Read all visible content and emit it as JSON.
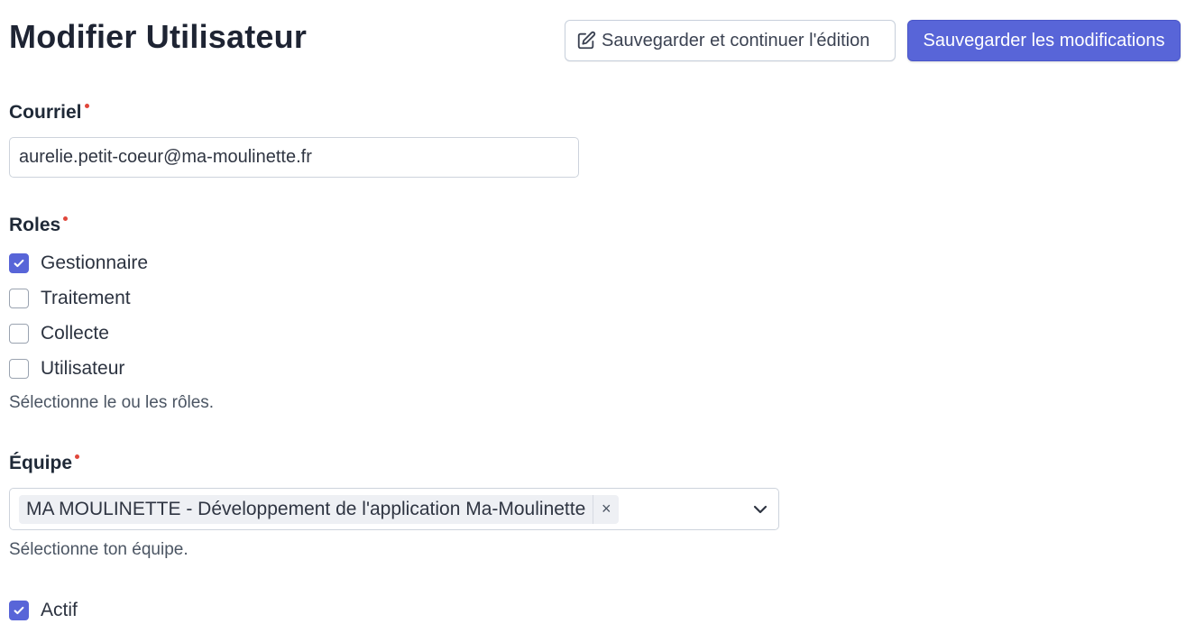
{
  "header": {
    "title": "Modifier Utilisateur",
    "save_continue_label": "Sauvegarder et continuer l'édition",
    "save_label": "Sauvegarder les modifications"
  },
  "form": {
    "email": {
      "label": "Courriel",
      "value": "aurelie.petit-coeur@ma-moulinette.fr"
    },
    "roles": {
      "label": "Roles",
      "options": [
        {
          "label": "Gestionnaire",
          "checked": true
        },
        {
          "label": "Traitement",
          "checked": false
        },
        {
          "label": "Collecte",
          "checked": false
        },
        {
          "label": "Utilisateur",
          "checked": false
        }
      ],
      "help": "Sélectionne le ou les rôles."
    },
    "team": {
      "label": "Équipe",
      "selected": "MA MOULINETTE - Développement de l'application Ma-Moulinette",
      "remove_glyph": "×",
      "help": "Sélectionne ton équipe."
    },
    "active": {
      "label": "Actif",
      "checked": true
    }
  },
  "colors": {
    "accent": "#5865d8",
    "required": "#e0473b"
  },
  "icons": {
    "edit": "edit-icon",
    "check": "check-icon",
    "chevron": "chevron-down-icon"
  }
}
